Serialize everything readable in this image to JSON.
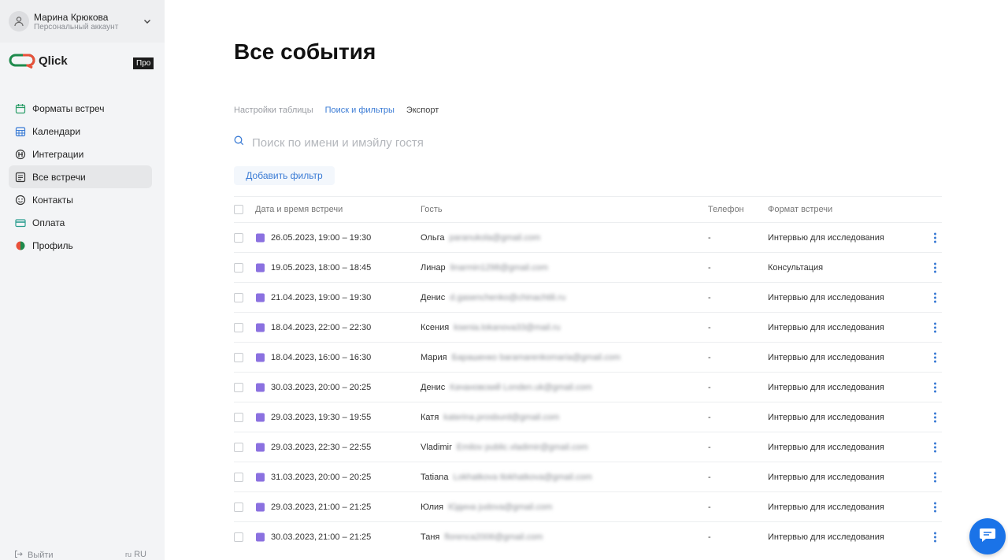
{
  "account": {
    "name": "Марина Крюкова",
    "subtitle": "Персональный аккаунт"
  },
  "brand": {
    "name": "Qlick",
    "plan_badge": "Про"
  },
  "nav": [
    {
      "label": "Форматы встреч",
      "icon": "calendar-check-icon",
      "active": false
    },
    {
      "label": "Календари",
      "icon": "calendar-grid-icon",
      "active": false
    },
    {
      "label": "Интеграции",
      "icon": "integrations-icon",
      "active": false
    },
    {
      "label": "Все встречи",
      "icon": "list-icon",
      "active": true
    },
    {
      "label": "Контакты",
      "icon": "smile-icon",
      "active": false
    },
    {
      "label": "Оплата",
      "icon": "card-icon",
      "active": false
    },
    {
      "label": "Профиль",
      "icon": "profile-icon",
      "active": false
    }
  ],
  "footer": {
    "logout": "Выйти",
    "lang": "RU",
    "lang_code": "ru"
  },
  "page": {
    "title": "Все события"
  },
  "tabs": [
    {
      "label": "Настройки таблицы",
      "state": "inactive"
    },
    {
      "label": "Поиск и фильтры",
      "state": "active"
    },
    {
      "label": "Экспорт",
      "state": "dark"
    }
  ],
  "search": {
    "placeholder": "Поиск по имени и имэйлу гостя",
    "value": ""
  },
  "add_filter_label": "Добавить фильтр",
  "table": {
    "headers": {
      "datetime": "Дата и время встречи",
      "guest": "Гость",
      "phone": "Телефон",
      "format": "Формат встречи"
    },
    "rows": [
      {
        "date": "26.05.2023,",
        "time": "19:00 – 19:30",
        "guest": "Ольга",
        "guest_extra": "paranukola@gmail.com",
        "phone": "-",
        "format": "Интервью для исследования"
      },
      {
        "date": "19.05.2023,",
        "time": "18:00 – 18:45",
        "guest": "Линар",
        "guest_extra": "linarmin1298@gmail.com",
        "phone": "-",
        "format": "Консультация"
      },
      {
        "date": "21.04.2023,",
        "time": "19:00 – 19:30",
        "guest": "Денис",
        "guest_extra": "d.gasenchenko@chinachtili.ru",
        "phone": "-",
        "format": "Интервью для исследования"
      },
      {
        "date": "18.04.2023,",
        "time": "22:00 – 22:30",
        "guest": "Ксения",
        "guest_extra": "ksenia.lokanova33@mail.ru",
        "phone": "-",
        "format": "Интервью для исследования"
      },
      {
        "date": "18.04.2023,",
        "time": "16:00 – 16:30",
        "guest": "Мария",
        "guest_extra": "Барашенко   baramarenkomaria@gmail.com",
        "phone": "-",
        "format": "Интервью для исследования"
      },
      {
        "date": "30.03.2023,",
        "time": "20:00 – 20:25",
        "guest": "Денис",
        "guest_extra": "Качановский   Londen.uk@gmail.com",
        "phone": "-",
        "format": "Интервью для исследования"
      },
      {
        "date": "29.03.2023,",
        "time": "19:30 – 19:55",
        "guest": "Катя",
        "guest_extra": "katerina.prosburd@gmail.com",
        "phone": "-",
        "format": "Интервью для исследования"
      },
      {
        "date": "29.03.2023,",
        "time": "22:30 – 22:55",
        "guest": "Vladimir",
        "guest_extra": "Emilov   public.vladimir@gmail.com",
        "phone": "-",
        "format": "Интервью для исследования"
      },
      {
        "date": "31.03.2023,",
        "time": "20:00 – 20:25",
        "guest": "Tatiana",
        "guest_extra": "Lokhatkova   tlokhatkova@gmail.com",
        "phone": "-",
        "format": "Интервью для исследования"
      },
      {
        "date": "29.03.2023,",
        "time": "21:00 – 21:25",
        "guest": "Юлия",
        "guest_extra": "Юдина   judova@gmail.com",
        "phone": "-",
        "format": "Интервью для исследования"
      },
      {
        "date": "30.03.2023,",
        "time": "21:00 – 21:25",
        "guest": "Таня",
        "guest_extra": "florenca2006@gmail.com",
        "phone": "-",
        "format": "Интервью для исследования"
      }
    ]
  },
  "colors": {
    "accent": "#3a7bd5",
    "event_swatch": "#8b71e0",
    "chat_button": "#1a73e8",
    "logo_green": "#1e8a4c",
    "logo_red": "#e8503a"
  },
  "chat_icon": "chat-bubble-icon"
}
